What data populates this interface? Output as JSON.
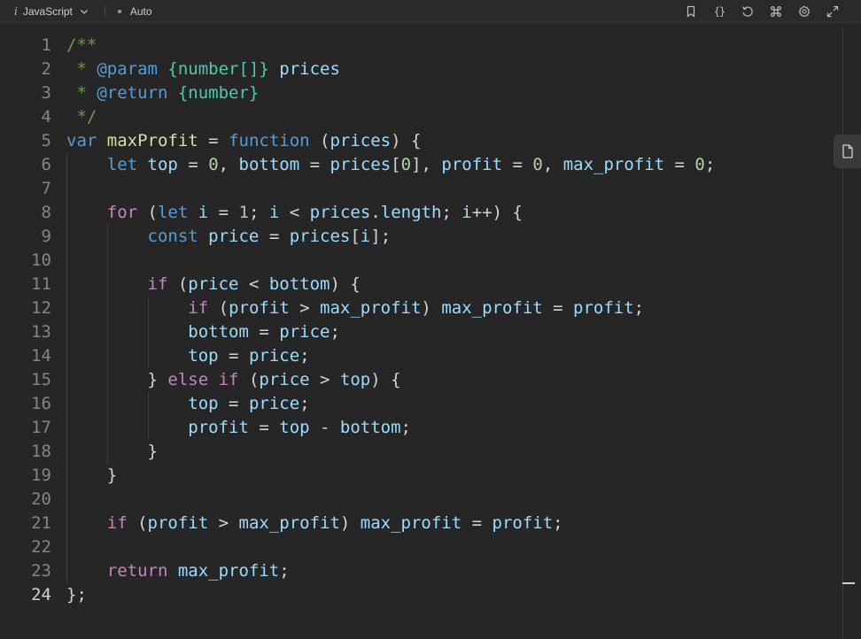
{
  "toolbar": {
    "info_glyph": "i",
    "language": "JavaScript",
    "mode": "Auto",
    "icons": [
      "bookmark-icon",
      "braces-icon",
      "reset-icon",
      "command-icon",
      "settings-icon",
      "expand-icon"
    ],
    "braces_label": "{}"
  },
  "editor": {
    "active_line": 24,
    "line_numbers": [
      "1",
      "2",
      "3",
      "4",
      "5",
      "6",
      "7",
      "8",
      "9",
      "10",
      "11",
      "12",
      "13",
      "14",
      "15",
      "16",
      "17",
      "18",
      "19",
      "20",
      "21",
      "22",
      "23",
      "24"
    ],
    "lines": [
      [
        [
          "com",
          "/**"
        ]
      ],
      [
        [
          "com",
          " * "
        ],
        [
          "doc",
          "@param"
        ],
        [
          "com",
          " "
        ],
        [
          "typ",
          "{number[]}"
        ],
        [
          "com",
          " "
        ],
        [
          "var",
          "prices"
        ]
      ],
      [
        [
          "com",
          " * "
        ],
        [
          "doc",
          "@return"
        ],
        [
          "com",
          " "
        ],
        [
          "typ",
          "{number}"
        ]
      ],
      [
        [
          "com",
          " */"
        ]
      ],
      [
        [
          "kw",
          "var"
        ],
        [
          "txt",
          " "
        ],
        [
          "fn",
          "maxProfit"
        ],
        [
          "txt",
          " = "
        ],
        [
          "kw",
          "function"
        ],
        [
          "txt",
          " ("
        ],
        [
          "var",
          "prices"
        ],
        [
          "txt",
          ") {"
        ]
      ],
      [
        [
          "txt",
          "    "
        ],
        [
          "kw",
          "let"
        ],
        [
          "txt",
          " "
        ],
        [
          "var",
          "top"
        ],
        [
          "txt",
          " = "
        ],
        [
          "num",
          "0"
        ],
        [
          "txt",
          ", "
        ],
        [
          "var",
          "bottom"
        ],
        [
          "txt",
          " = "
        ],
        [
          "var",
          "prices"
        ],
        [
          "txt",
          "["
        ],
        [
          "num",
          "0"
        ],
        [
          "txt",
          "], "
        ],
        [
          "var",
          "profit"
        ],
        [
          "txt",
          " = "
        ],
        [
          "num",
          "0"
        ],
        [
          "txt",
          ", "
        ],
        [
          "var",
          "max_profit"
        ],
        [
          "txt",
          " = "
        ],
        [
          "num",
          "0"
        ],
        [
          "txt",
          ";"
        ]
      ],
      [],
      [
        [
          "txt",
          "    "
        ],
        [
          "ctl",
          "for"
        ],
        [
          "txt",
          " ("
        ],
        [
          "kw",
          "let"
        ],
        [
          "txt",
          " "
        ],
        [
          "var",
          "i"
        ],
        [
          "txt",
          " = "
        ],
        [
          "num",
          "1"
        ],
        [
          "txt",
          "; "
        ],
        [
          "var",
          "i"
        ],
        [
          "txt",
          " < "
        ],
        [
          "var",
          "prices"
        ],
        [
          "txt",
          "."
        ],
        [
          "var",
          "length"
        ],
        [
          "txt",
          "; "
        ],
        [
          "var",
          "i"
        ],
        [
          "txt",
          "++) {"
        ]
      ],
      [
        [
          "txt",
          "        "
        ],
        [
          "kw",
          "const"
        ],
        [
          "txt",
          " "
        ],
        [
          "var",
          "price"
        ],
        [
          "txt",
          " = "
        ],
        [
          "var",
          "prices"
        ],
        [
          "txt",
          "["
        ],
        [
          "var",
          "i"
        ],
        [
          "txt",
          "];"
        ]
      ],
      [],
      [
        [
          "txt",
          "        "
        ],
        [
          "ctl",
          "if"
        ],
        [
          "txt",
          " ("
        ],
        [
          "var",
          "price"
        ],
        [
          "txt",
          " < "
        ],
        [
          "var",
          "bottom"
        ],
        [
          "txt",
          ") {"
        ]
      ],
      [
        [
          "txt",
          "            "
        ],
        [
          "ctl",
          "if"
        ],
        [
          "txt",
          " ("
        ],
        [
          "var",
          "profit"
        ],
        [
          "txt",
          " > "
        ],
        [
          "var",
          "max_profit"
        ],
        [
          "txt",
          ") "
        ],
        [
          "var",
          "max_profit"
        ],
        [
          "txt",
          " = "
        ],
        [
          "var",
          "profit"
        ],
        [
          "txt",
          ";"
        ]
      ],
      [
        [
          "txt",
          "            "
        ],
        [
          "var",
          "bottom"
        ],
        [
          "txt",
          " = "
        ],
        [
          "var",
          "price"
        ],
        [
          "txt",
          ";"
        ]
      ],
      [
        [
          "txt",
          "            "
        ],
        [
          "var",
          "top"
        ],
        [
          "txt",
          " = "
        ],
        [
          "var",
          "price"
        ],
        [
          "txt",
          ";"
        ]
      ],
      [
        [
          "txt",
          "        } "
        ],
        [
          "ctl",
          "else"
        ],
        [
          "txt",
          " "
        ],
        [
          "ctl",
          "if"
        ],
        [
          "txt",
          " ("
        ],
        [
          "var",
          "price"
        ],
        [
          "txt",
          " > "
        ],
        [
          "var",
          "top"
        ],
        [
          "txt",
          ") {"
        ]
      ],
      [
        [
          "txt",
          "            "
        ],
        [
          "var",
          "top"
        ],
        [
          "txt",
          " = "
        ],
        [
          "var",
          "price"
        ],
        [
          "txt",
          ";"
        ]
      ],
      [
        [
          "txt",
          "            "
        ],
        [
          "var",
          "profit"
        ],
        [
          "txt",
          " = "
        ],
        [
          "var",
          "top"
        ],
        [
          "txt",
          " - "
        ],
        [
          "var",
          "bottom"
        ],
        [
          "txt",
          ";"
        ]
      ],
      [
        [
          "txt",
          "        }"
        ]
      ],
      [
        [
          "txt",
          "    }"
        ]
      ],
      [],
      [
        [
          "txt",
          "    "
        ],
        [
          "ctl",
          "if"
        ],
        [
          "txt",
          " ("
        ],
        [
          "var",
          "profit"
        ],
        [
          "txt",
          " > "
        ],
        [
          "var",
          "max_profit"
        ],
        [
          "txt",
          ") "
        ],
        [
          "var",
          "max_profit"
        ],
        [
          "txt",
          " = "
        ],
        [
          "var",
          "profit"
        ],
        [
          "txt",
          ";"
        ]
      ],
      [],
      [
        [
          "txt",
          "    "
        ],
        [
          "ctl",
          "return"
        ],
        [
          "txt",
          " "
        ],
        [
          "var",
          "max_profit"
        ],
        [
          "txt",
          ";"
        ]
      ],
      [
        [
          "txt",
          "};"
        ]
      ]
    ]
  },
  "colors": {
    "background": "#262626",
    "comment": "#6a9955",
    "keyword": "#569cd6",
    "control": "#c586c0",
    "variable": "#9cdcfe",
    "function": "#dcdcaa",
    "number": "#b5cea8",
    "type": "#4ec9b0"
  }
}
